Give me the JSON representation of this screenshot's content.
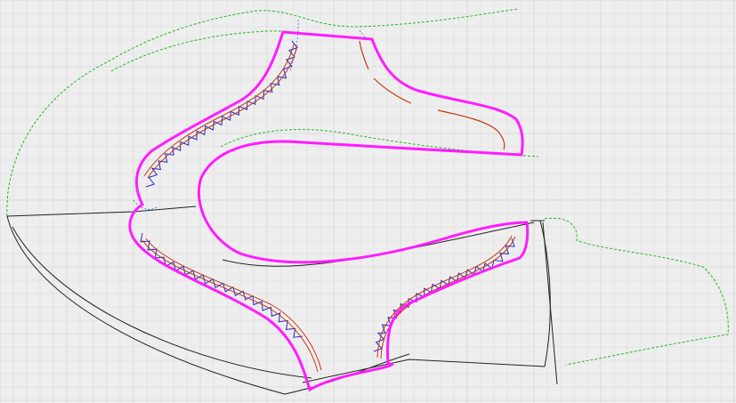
{
  "colors": {
    "background": "#eeeeee",
    "grid": "#d9d9dd",
    "cut_line": "#ff1cff",
    "outline": "#222222",
    "seam_allowance": "#22b822",
    "notch": "#1f2bc8",
    "stitch": "#c43a12",
    "construction": "#2b6ee0"
  },
  "view": {
    "grid_visible": true,
    "tool": "pattern-editor-canvas"
  }
}
